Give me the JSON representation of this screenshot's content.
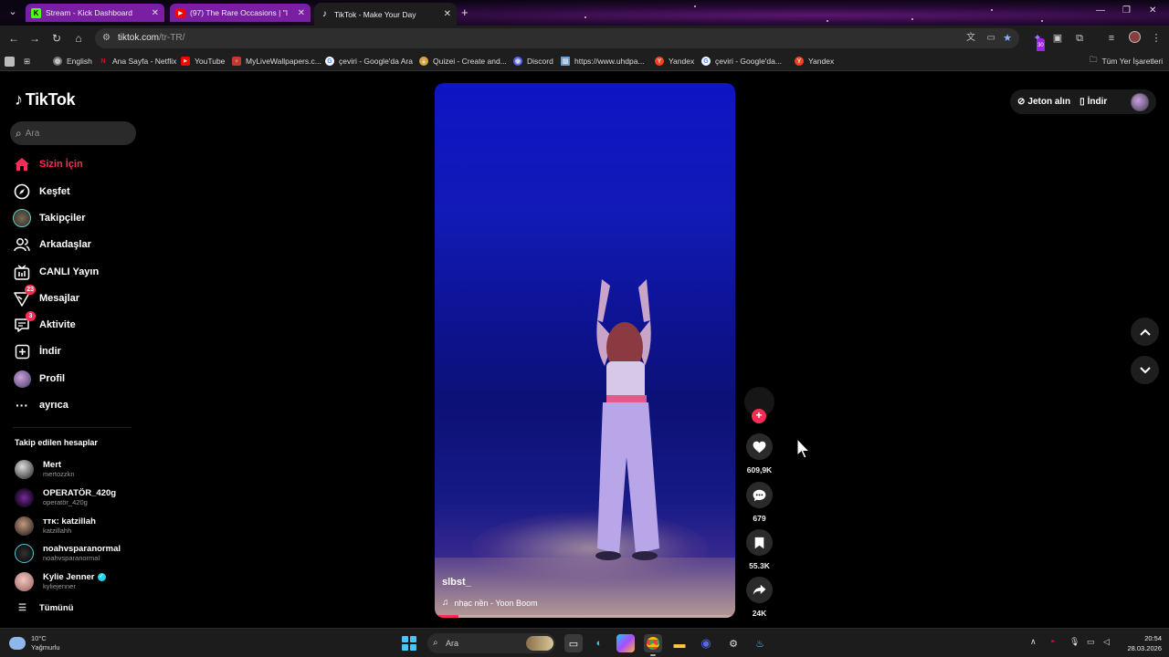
{
  "browser": {
    "tabs": [
      {
        "title": "Stream - Kick Dashboard",
        "icon": "kick-icon",
        "color": "#53fc18",
        "active": false
      },
      {
        "title": "(97) The Rare Occasions | \"I",
        "icon": "youtube-icon",
        "color": "#ff0000",
        "active": false
      },
      {
        "title": "TikTok - Make Your Day",
        "icon": "tiktok-icon",
        "color": "#ffffff",
        "active": true
      }
    ],
    "url_host": "tiktok.com",
    "url_path": "/tr-TR/",
    "bookmarks": [
      {
        "label": "English",
        "icon": "globe-icon"
      },
      {
        "label": "Ana Sayfa - Netflix",
        "icon": "netflix-icon"
      },
      {
        "label": "YouTube",
        "icon": "youtube-icon"
      },
      {
        "label": "MyLiveWallpapers.c...",
        "icon": "wallpaper-icon"
      },
      {
        "label": "çeviri - Google'da Ara",
        "icon": "google-icon"
      },
      {
        "label": "Quizei - Create and...",
        "icon": "quizei-icon"
      },
      {
        "label": "Discord",
        "icon": "discord-icon"
      },
      {
        "label": "https://www.uhdpa...",
        "icon": "image-icon"
      },
      {
        "label": "Yandex",
        "icon": "yandex-icon"
      },
      {
        "label": "çeviri - Google'da...",
        "icon": "google-icon"
      },
      {
        "label": "Yandex",
        "icon": "yandex-icon"
      }
    ],
    "all_bookmarks": "Tüm Yer İşaretleri",
    "extension_badge": "30"
  },
  "tiktok": {
    "logo": "TikTok",
    "search_placeholder": "Ara",
    "nav": [
      {
        "label": "Sizin İçin",
        "icon": "home-icon",
        "active": true
      },
      {
        "label": "Keşfet",
        "icon": "compass-icon"
      },
      {
        "label": "Takipçiler",
        "icon": "followers-avatar-icon"
      },
      {
        "label": "Arkadaşlar",
        "icon": "friends-icon"
      },
      {
        "label": "CANLI Yayın",
        "icon": "live-icon"
      },
      {
        "label": "Mesajlar",
        "icon": "messages-icon",
        "badge": "23"
      },
      {
        "label": "Aktivite",
        "icon": "activity-icon",
        "badge": "3"
      },
      {
        "label": "İndir",
        "icon": "download-icon"
      },
      {
        "label": "Profil",
        "icon": "profile-icon"
      },
      {
        "label": "ayrıca",
        "icon": "more-icon"
      }
    ],
    "following_title": "Takip edilen hesaplar",
    "following": [
      {
        "name": "Mert",
        "username": "mertozzkn",
        "verified": false
      },
      {
        "name": "OPERATÖR_420g",
        "username": "operatör_420g",
        "verified": false
      },
      {
        "name": "ᴛᴛᴋ: katzillah",
        "username": "katzillahh",
        "verified": false
      },
      {
        "name": "noahvsparanormal",
        "username": "noahvsparanormal",
        "verified": false
      },
      {
        "name": "Kylie Jenner",
        "username": "kyliejenner",
        "verified": true
      }
    ],
    "see_all": "Tümünü",
    "top_right": {
      "coins": "Jeton alın",
      "download": "İndir"
    },
    "video": {
      "username": "slbst_",
      "music": "nhạc nền - Yoon Boom",
      "progress": 0.08
    },
    "actions": {
      "likes": "609,9K",
      "comments": "679",
      "saves": "55.3K",
      "shares": "24K"
    }
  },
  "taskbar": {
    "weather_temp": "10°C",
    "weather_desc": "Yağmurlu",
    "search_placeholder": "Ara",
    "time": "20:54",
    "date": "28.03.2026"
  }
}
